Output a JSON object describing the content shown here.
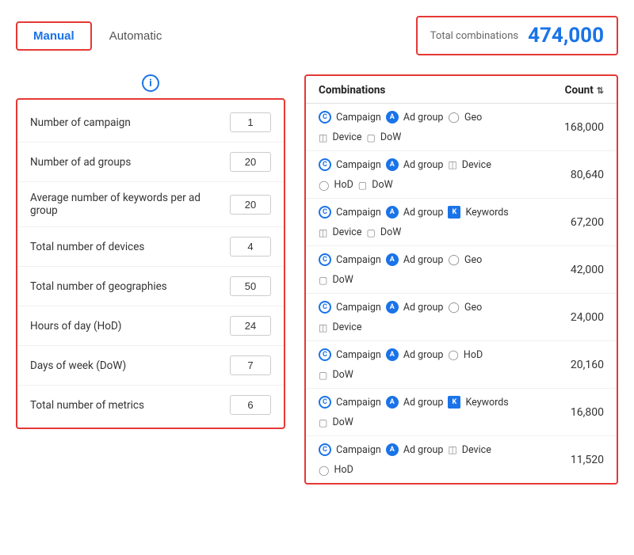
{
  "tabs": {
    "manual": "Manual",
    "automatic": "Automatic"
  },
  "total": {
    "label": "Total combinations",
    "value": "474,000"
  },
  "inputs": {
    "fields": [
      {
        "label": "Number of campaign",
        "value": "1"
      },
      {
        "label": "Number of ad groups",
        "value": "20"
      },
      {
        "label": "Average number of keywords per ad group",
        "value": "20"
      },
      {
        "label": "Total number of devices",
        "value": "4"
      },
      {
        "label": "Total number of geographies",
        "value": "50"
      },
      {
        "label": "Hours of day (HoD)",
        "value": "24"
      },
      {
        "label": "Days of week (DoW)",
        "value": "7"
      },
      {
        "label": "Total number of metrics",
        "value": "6"
      }
    ]
  },
  "table": {
    "col_combinations": "Combinations",
    "col_count": "Count",
    "rows": [
      {
        "tags": [
          {
            "type": "campaign",
            "label": "Campaign"
          },
          {
            "type": "adgroup",
            "label": "Ad group"
          },
          {
            "type": "geo",
            "label": "Geo"
          },
          {
            "type": "device",
            "label": "Device"
          },
          {
            "type": "dow",
            "label": "DoW"
          }
        ],
        "count": "168,000"
      },
      {
        "tags": [
          {
            "type": "campaign",
            "label": "Campaign"
          },
          {
            "type": "adgroup",
            "label": "Ad group"
          },
          {
            "type": "device",
            "label": "Device"
          },
          {
            "type": "hod",
            "label": "HoD"
          },
          {
            "type": "dow",
            "label": "DoW"
          }
        ],
        "count": "80,640"
      },
      {
        "tags": [
          {
            "type": "campaign",
            "label": "Campaign"
          },
          {
            "type": "adgroup",
            "label": "Ad group"
          },
          {
            "type": "keywords",
            "label": "Keywords"
          },
          {
            "type": "device",
            "label": "Device"
          },
          {
            "type": "dow",
            "label": "DoW"
          }
        ],
        "count": "67,200"
      },
      {
        "tags": [
          {
            "type": "campaign",
            "label": "Campaign"
          },
          {
            "type": "adgroup",
            "label": "Ad group"
          },
          {
            "type": "geo",
            "label": "Geo"
          },
          {
            "type": "dow",
            "label": "DoW"
          }
        ],
        "count": "42,000"
      },
      {
        "tags": [
          {
            "type": "campaign",
            "label": "Campaign"
          },
          {
            "type": "adgroup",
            "label": "Ad group"
          },
          {
            "type": "geo",
            "label": "Geo"
          },
          {
            "type": "device",
            "label": "Device"
          }
        ],
        "count": "24,000"
      },
      {
        "tags": [
          {
            "type": "campaign",
            "label": "Campaign"
          },
          {
            "type": "adgroup",
            "label": "Ad group"
          },
          {
            "type": "hod",
            "label": "HoD"
          },
          {
            "type": "dow",
            "label": "DoW"
          }
        ],
        "count": "20,160"
      },
      {
        "tags": [
          {
            "type": "campaign",
            "label": "Campaign"
          },
          {
            "type": "adgroup",
            "label": "Ad group"
          },
          {
            "type": "keywords",
            "label": "Keywords"
          },
          {
            "type": "dow",
            "label": "DoW"
          }
        ],
        "count": "16,800"
      },
      {
        "tags": [
          {
            "type": "campaign",
            "label": "Campaign"
          },
          {
            "type": "adgroup",
            "label": "Ad group"
          },
          {
            "type": "device",
            "label": "Device"
          },
          {
            "type": "hod",
            "label": "HoD"
          }
        ],
        "count": "11,520"
      }
    ]
  }
}
